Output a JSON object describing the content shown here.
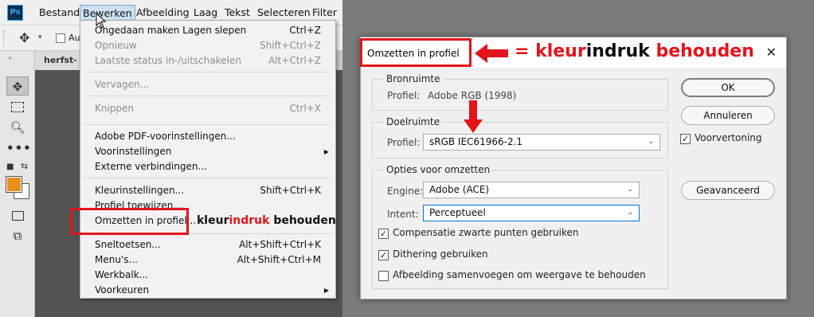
{
  "app": {
    "logo": "Ps",
    "menubar": [
      "Bestand",
      "Bewerken",
      "Afbeelding",
      "Laag",
      "Tekst",
      "Selecteren",
      "Filter"
    ],
    "option_bar": {
      "auto_label": "Au"
    },
    "doc_tab": "herfst-LF"
  },
  "bewerken_menu": [
    {
      "label": "Ongedaan maken Lagen slepen",
      "shortcut": "Ctrl+Z",
      "enabled": true
    },
    {
      "label": "Opnieuw",
      "shortcut": "Shift+Ctrl+Z",
      "enabled": false
    },
    {
      "label": "Laatste status in-/uitschakelen",
      "shortcut": "Alt+Ctrl+Z",
      "enabled": false
    },
    {
      "label": "Vervagen...",
      "shortcut": "",
      "enabled": false
    },
    {
      "label": "Knippen",
      "shortcut": "Ctrl+X",
      "enabled": false
    },
    {
      "label": "Adobe PDF-voorinstellingen...",
      "shortcut": "",
      "enabled": true
    },
    {
      "label": "Voorinstellingen",
      "shortcut": "",
      "enabled": true,
      "submenu": true
    },
    {
      "label": "Externe verbindingen...",
      "shortcut": "",
      "enabled": true
    },
    {
      "label": "Kleurinstellingen...",
      "shortcut": "Shift+Ctrl+K",
      "enabled": true
    },
    {
      "label": "Profiel toewijzen...",
      "shortcut": "",
      "enabled": true
    },
    {
      "label": "Omzetten in profiel...",
      "shortcut": "",
      "enabled": true
    },
    {
      "label": "Sneltoetsen...",
      "shortcut": "Alt+Shift+Ctrl+K",
      "enabled": true
    },
    {
      "label": "Menu's...",
      "shortcut": "Alt+Shift+Ctrl+M",
      "enabled": true
    },
    {
      "label": "Werkbalk...",
      "shortcut": "",
      "enabled": true
    },
    {
      "label": "Voorkeuren",
      "shortcut": "",
      "enabled": true,
      "submenu": true
    }
  ],
  "annotation_small": {
    "part1": "kleur",
    "part2": "indruk",
    "part3": " behouden"
  },
  "annotation_big": {
    "eq": "= ",
    "part1": "kleur",
    "part2": "indruk",
    "part3": " behouden"
  },
  "dialog": {
    "title": "Omzetten in profiel",
    "close": "✕",
    "bronruimte": {
      "legend": "Bronruimte",
      "profile_label": "Profiel:",
      "profile_value": "Adobe RGB (1998)"
    },
    "doelruimte": {
      "legend": "Doelruimte",
      "profile_label": "Profiel:",
      "profile_value": "sRGB IEC61966-2.1"
    },
    "opties": {
      "legend": "Opties voor omzetten",
      "engine_label": "Engine:",
      "engine_value": "Adobe (ACE)",
      "intent_label": "Intent:",
      "intent_value": "Perceptueel",
      "cb1": "Compensatie zwarte punten gebruiken",
      "cb1_checked": true,
      "cb2": "Dithering gebruiken",
      "cb2_checked": true,
      "cb3": "Afbeelding samenvoegen om weergave te behouden",
      "cb3_checked": false
    },
    "buttons": {
      "ok": "OK",
      "cancel": "Annuleren",
      "advanced": "Geavanceerd"
    },
    "preview": {
      "label": "Voorvertoning",
      "checked": true
    }
  },
  "colors": {
    "accent_red": "#e4141b",
    "foreground_swatch": "#e8901c",
    "ps_blue": "#31a8ff"
  }
}
